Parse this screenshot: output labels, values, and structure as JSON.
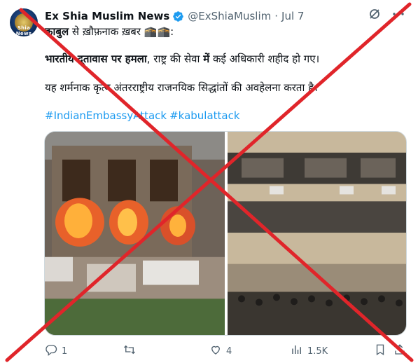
{
  "tweet": {
    "author_name": "Ex Shia Muslim News",
    "handle": "@ExShiaMuslim",
    "separator": "·",
    "time": "Jul 7",
    "avatar_text": "Shia News",
    "line1_prefix": "काबुल",
    "line1_rest": " से ख़ौफ़नाक ख़बर 🕋🕋:",
    "line2_bold1": "भारतीय दूतावास पर हमला",
    "line2_mid": ", राष्ट्र की सेवा ",
    "line2_bold2": "में",
    "line2_rest": " कई अधिकारी शहीद हो गए।",
    "line3": "यह शर्मनाक कृत्य अंतरराष्ट्रीय राजनयिक सिद्धांतों की अवहेलना करता है।",
    "hashtags": [
      "#IndianEmbassyAttack",
      "#kabulattack"
    ]
  },
  "metrics": {
    "replies": "1",
    "likes": "4",
    "views": "1.5K"
  },
  "icons": {
    "verified": "verified-badge-icon",
    "grok": "grok-icon",
    "more": "more-options-icon",
    "reply": "reply-icon",
    "retweet": "retweet-icon",
    "like": "like-icon",
    "views": "views-icon",
    "bookmark": "bookmark-icon",
    "share": "share-icon"
  },
  "colors": {
    "link": "#1d9bf0",
    "secondary_text": "#536471",
    "overlay_cross": "#e0252a"
  }
}
